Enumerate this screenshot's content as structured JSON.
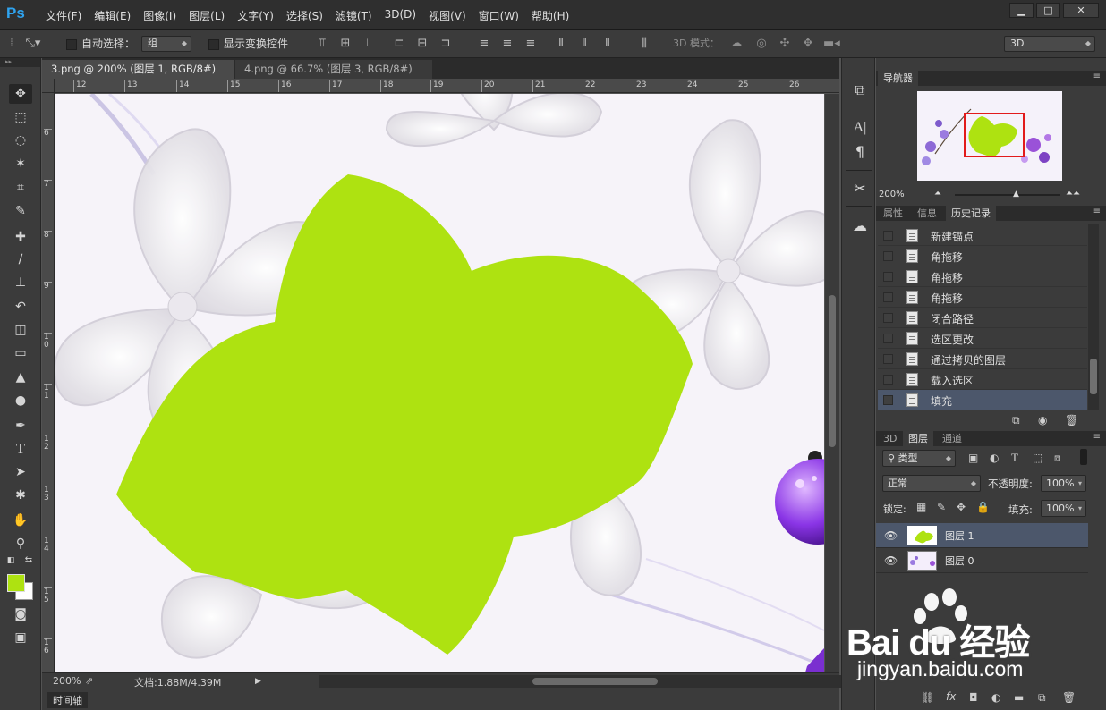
{
  "app": {
    "logo": "Ps"
  },
  "menubar": {
    "items": [
      "文件(F)",
      "编辑(E)",
      "图像(I)",
      "图层(L)",
      "文字(Y)",
      "选择(S)",
      "滤镜(T)",
      "3D(D)",
      "视图(V)",
      "窗口(W)",
      "帮助(H)"
    ],
    "window_controls": [
      "▁",
      "□",
      "✕"
    ]
  },
  "options": {
    "auto_select_label": "自动选择：",
    "auto_select_value": "组",
    "show_transform_label": "显示变换控件",
    "mode_3d_label": "3D 模式：",
    "workspace_value": "3D"
  },
  "document_tabs": [
    {
      "label": "3.png @ 200% (图层 1, RGB/8#) *",
      "close": "×"
    },
    {
      "label": "4.png @ 66.7% (图层 3, RGB/8#) *",
      "close": "×"
    }
  ],
  "rulers": {
    "top": [
      "12",
      "13",
      "14",
      "15",
      "16",
      "17",
      "18",
      "19",
      "20",
      "21",
      "22",
      "23",
      "24",
      "25",
      "26"
    ],
    "left": [
      "6",
      "7",
      "8",
      "9",
      "10",
      "11",
      "12",
      "13",
      "14",
      "15",
      "16"
    ]
  },
  "status": {
    "zoom": "200%",
    "doc_info": "文档:1.88M/4.39M"
  },
  "timeline": {
    "label": "时间轴"
  },
  "navigator": {
    "tab": "导航器",
    "zoom": "200%"
  },
  "history_panel": {
    "tabs": [
      "属性",
      "信息",
      "历史记录"
    ],
    "active_tab": "历史记录",
    "items": [
      "新建锚点",
      "角拖移",
      "角拖移",
      "角拖移",
      "闭合路径",
      "选区更改",
      "通过拷贝的图层",
      "载入选区",
      "填充"
    ],
    "selected_index": 8
  },
  "layers_panel": {
    "tabs": [
      "3D",
      "图层",
      "通道"
    ],
    "active_tab": "图层",
    "filter_kind": "类型",
    "blend_mode": "正常",
    "opacity_label": "不透明度:",
    "opacity_value": "100%",
    "lock_label": "锁定:",
    "fill_label": "填充:",
    "fill_value": "100%",
    "layers": [
      {
        "name": "图层 1",
        "selected": true
      },
      {
        "name": "图层 0",
        "selected": false
      }
    ]
  },
  "watermark": {
    "text": "Bai du 经验",
    "url": "jingyan.baidu.com"
  },
  "colors": {
    "foreground": "#aee211",
    "background": "#ffffff",
    "fill_shape": "#aee211",
    "selection_highlight": "#4c576b",
    "ps_blue": "#2fa3ef"
  }
}
